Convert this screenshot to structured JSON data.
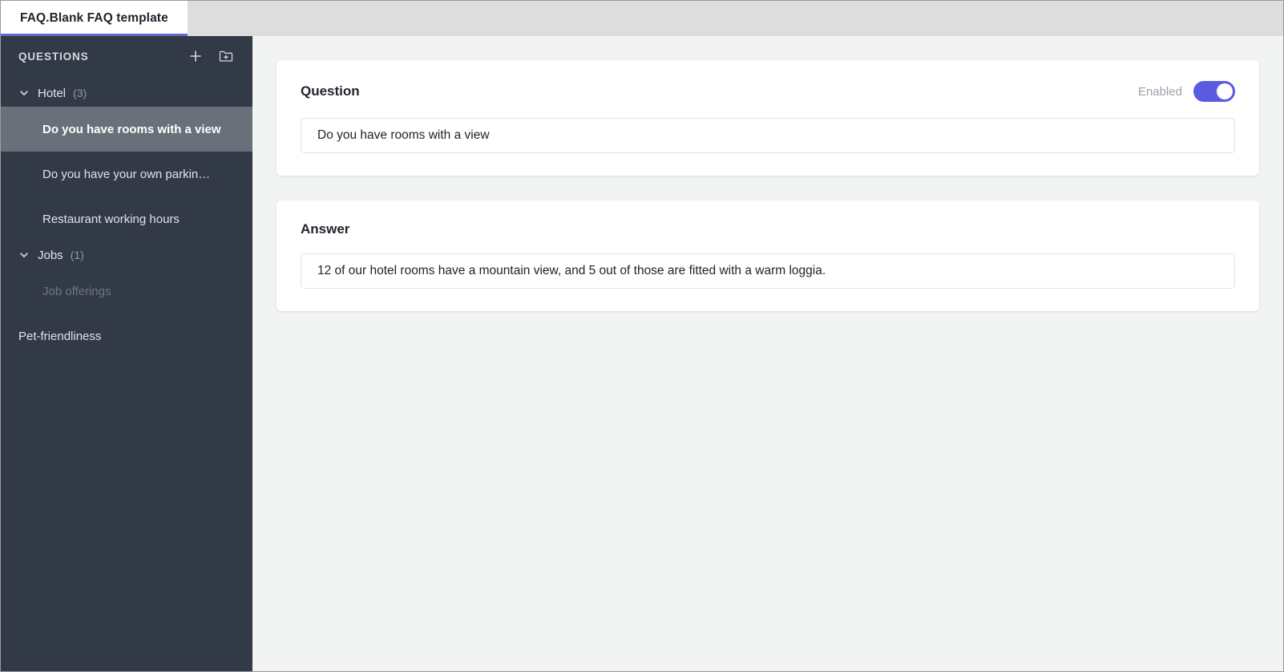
{
  "window": {
    "tab": {
      "title": "FAQ.Blank FAQ template",
      "accent_color": "#6366cf"
    }
  },
  "sidebar": {
    "header": {
      "title": "QUESTIONS",
      "add_icon": "plus-icon",
      "add_folder_icon": "folder-plus-icon"
    },
    "background_color": "#333a47",
    "selected_color": "#6a7079",
    "tree": [
      {
        "type": "group",
        "label": "Hotel",
        "count": "(3)",
        "expanded": true,
        "children": [
          {
            "label": "Do you have rooms with a view",
            "selected": true,
            "dimmed": false
          },
          {
            "label": "Do you have your own parkin…",
            "selected": false,
            "dimmed": false
          },
          {
            "label": "Restaurant working hours",
            "selected": false,
            "dimmed": false
          }
        ]
      },
      {
        "type": "group",
        "label": "Jobs",
        "count": "(1)",
        "expanded": true,
        "children": [
          {
            "label": "Job offerings",
            "selected": false,
            "dimmed": true
          }
        ]
      },
      {
        "type": "item",
        "label": "Pet-friendliness",
        "selected": false,
        "dimmed": false
      }
    ]
  },
  "main": {
    "question_card": {
      "title": "Question",
      "toggle": {
        "label": "Enabled",
        "state": "on",
        "on_color": "#5b5be0"
      },
      "input": {
        "value": "Do you have rooms with a view",
        "placeholder": "Question"
      }
    },
    "answer_card": {
      "title": "Answer",
      "input": {
        "value": "12 of our hotel rooms have a mountain view, and 5 out of those are fitted with a warm loggia.",
        "placeholder": "Answer"
      }
    }
  }
}
